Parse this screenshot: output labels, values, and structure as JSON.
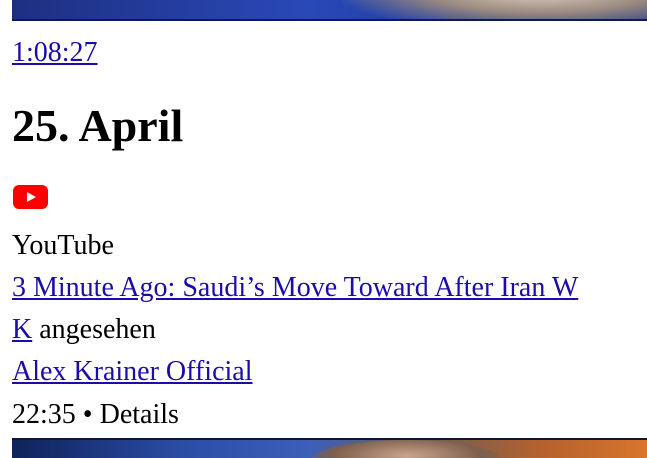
{
  "previous_result": {
    "duration": "1:08:27"
  },
  "date_group": {
    "heading": "25. April"
  },
  "video": {
    "source_icon": "youtube-icon",
    "source": "YouTube",
    "title": "3 Minute Ago: Saudi’s Move Toward After Iran W",
    "views_count": "K",
    "views_suffix": " angesehen",
    "channel": "Alex Krainer Official",
    "duration": "22:35",
    "separator": " • ",
    "details_label": "Details"
  },
  "colors": {
    "link": "#1a0dab",
    "youtube_red": "#ff0000",
    "text": "#000000"
  }
}
